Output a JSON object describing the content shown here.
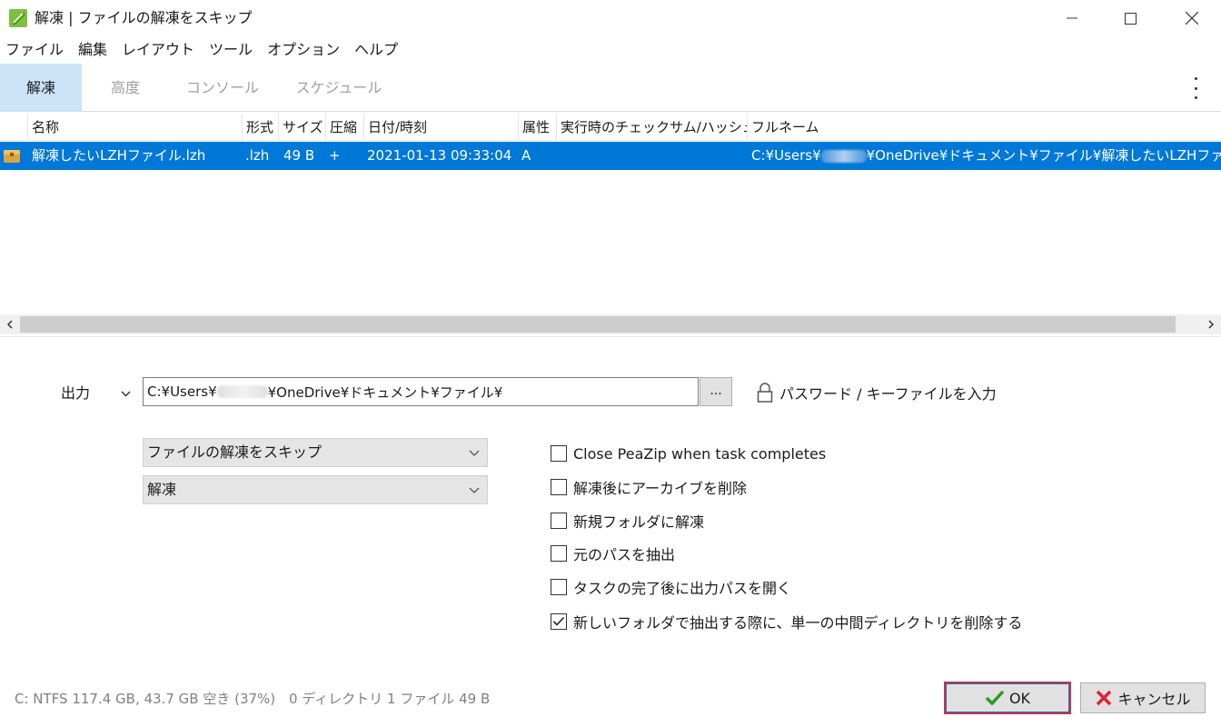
{
  "window": {
    "title": "解凍 | ファイルの解凍をスキップ",
    "app_icon": "peazip-icon"
  },
  "menu": [
    "ファイル",
    "編集",
    "レイアウト",
    "ツール",
    "オプション",
    "ヘルプ"
  ],
  "tabs": [
    {
      "label": "解凍",
      "active": true
    },
    {
      "label": "高度",
      "active": false
    },
    {
      "label": "コンソール",
      "active": false
    },
    {
      "label": "スケジュール",
      "active": false
    }
  ],
  "table": {
    "columns": [
      "名称",
      "形式",
      "サイズ",
      "圧縮",
      "日付/時刻",
      "属性",
      "実行時のチェックサム/ハッシュ",
      "フルネーム"
    ],
    "rows": [
      {
        "name": "解凍したいLZHファイル.lzh",
        "type": ".lzh",
        "size": "49 B",
        "compressed": "+",
        "datetime": "2021-01-13 09:33:04",
        "attr": "A",
        "checksum": "",
        "fullname_prefix": "C:¥Users¥",
        "fullname_suffix": "¥OneDrive¥ドキュメント¥ファイル¥解凍したいLZHファイル",
        "selected": true
      }
    ]
  },
  "output": {
    "label": "出力",
    "path_prefix": "C:¥Users¥",
    "path_suffix": "¥OneDrive¥ドキュメント¥ファイル¥",
    "browse_label": "...",
    "password_label": "パスワード / キーファイルを入力"
  },
  "dropdowns": {
    "overwrite": "ファイルの解凍をスキップ",
    "mode": "解凍"
  },
  "options": [
    {
      "label": "Close PeaZip when task completes",
      "checked": false
    },
    {
      "label": "解凍後にアーカイブを削除",
      "checked": false
    },
    {
      "label": "新規フォルダに解凍",
      "checked": false
    },
    {
      "label": "元のパスを抽出",
      "checked": false
    },
    {
      "label": "タスクの完了後に出力パスを開く",
      "checked": false
    },
    {
      "label": "新しいフォルダで抽出する際に、単一の中間ディレクトリを削除する",
      "checked": true
    }
  ],
  "status": {
    "disk": "C: NTFS 117.4 GB, 43.7 GB 空き (37%)",
    "count": "0 ディレクトリ 1 ファイル 49 B"
  },
  "buttons": {
    "ok": "OK",
    "cancel": "キャンセル"
  },
  "colors": {
    "selection": "#0078d7",
    "tab_active": "#cce4f7",
    "ok_check": "#2a9a2a",
    "cancel_x": "#d9262e"
  }
}
